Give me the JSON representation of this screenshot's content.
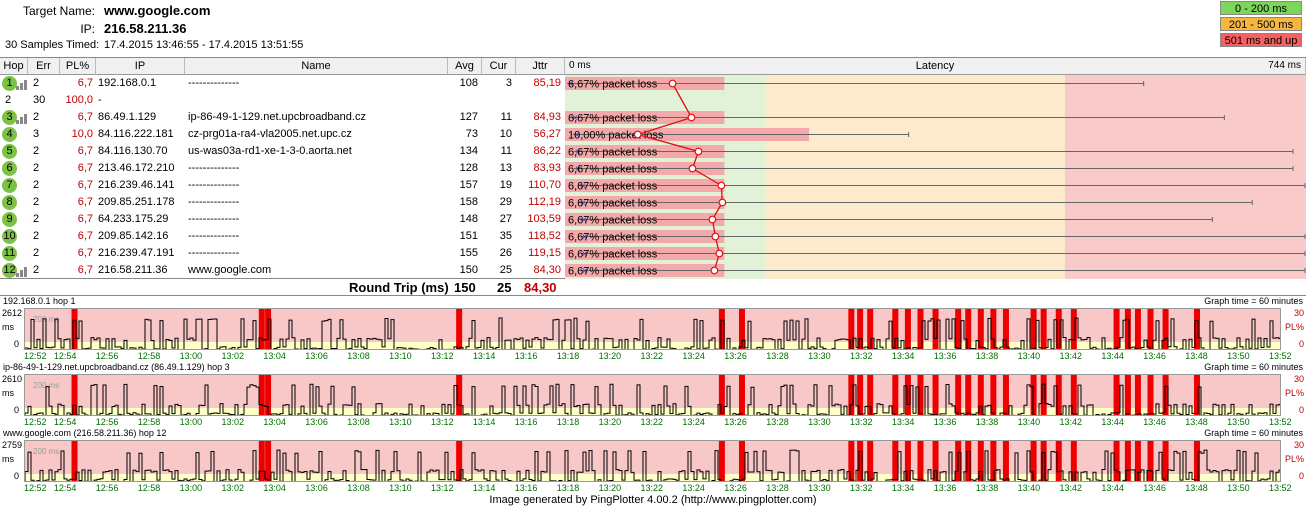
{
  "header": {
    "target_label": "Target Name:",
    "target_value": "www.google.com",
    "ip_label": "IP:",
    "ip_value": "216.58.211.36",
    "samples_label": "30 Samples Timed:",
    "samples_value": "17.4.2015 13:46:55 - 17.4.2015 13:51:55",
    "legend": [
      {
        "label": "0 - 200 ms",
        "color": "#7cd65a"
      },
      {
        "label": "201 - 500 ms",
        "color": "#f5b742"
      },
      {
        "label": "501 ms and up",
        "color": "#f56060"
      }
    ]
  },
  "columns": {
    "hop": "Hop",
    "err": "Err",
    "pl": "PL%",
    "ip": "IP",
    "name": "Name",
    "avg": "Avg",
    "cur": "Cur",
    "jttr": "Jttr",
    "latency": "Latency",
    "lat_min": "0 ms",
    "lat_max": "744 ms"
  },
  "hops": [
    {
      "hop": "1",
      "err": "2",
      "pl": "6,7",
      "ip": "192.168.0.1",
      "name": "--------------",
      "avg": "108",
      "cur": "3",
      "jttr": "85,19",
      "loss": "6,67% packet loss",
      "badge": true,
      "bars": true,
      "avg_ms": 108,
      "min_ms": 2,
      "max_ms": 581,
      "bar_ms": 160
    },
    {
      "hop": "2",
      "err": "30",
      "pl": "100,0",
      "ip": "-",
      "name": "",
      "avg": "",
      "cur": "",
      "jttr": "",
      "loss": "",
      "badge": false,
      "bars": false
    },
    {
      "hop": "3",
      "err": "2",
      "pl": "6,7",
      "ip": "86.49.1.129",
      "name": "ip-86-49-1-129.net.upcbroadband.cz",
      "avg": "127",
      "cur": "11",
      "jttr": "84,93",
      "loss": "6,67% packet loss",
      "badge": true,
      "bars": true,
      "avg_ms": 127,
      "min_ms": 6,
      "max_ms": 662,
      "bar_ms": 160
    },
    {
      "hop": "4",
      "err": "3",
      "pl": "10,0",
      "ip": "84.116.222.181",
      "name": "cz-prg01a-ra4-vla2005.net.upc.cz",
      "avg": "73",
      "cur": "10",
      "jttr": "56,27",
      "loss": "10,00% packet loss",
      "badge": true,
      "bars": false,
      "avg_ms": 73,
      "min_ms": 8,
      "max_ms": 345,
      "bar_ms": 245
    },
    {
      "hop": "5",
      "err": "2",
      "pl": "6,7",
      "ip": "84.116.130.70",
      "name": "us-was03a-rd1-xe-1-3-0.aorta.net",
      "avg": "134",
      "cur": "11",
      "jttr": "86,22",
      "loss": "6,67% packet loss",
      "badge": true,
      "bars": false,
      "avg_ms": 134,
      "min_ms": 9,
      "max_ms": 731,
      "bar_ms": 160
    },
    {
      "hop": "6",
      "err": "2",
      "pl": "6,7",
      "ip": "213.46.172.210",
      "name": "--------------",
      "avg": "128",
      "cur": "13",
      "jttr": "83,93",
      "loss": "6,67% packet loss",
      "badge": true,
      "bars": false,
      "avg_ms": 128,
      "min_ms": 9,
      "max_ms": 731,
      "bar_ms": 160
    },
    {
      "hop": "7",
      "err": "2",
      "pl": "6,7",
      "ip": "216.239.46.141",
      "name": "--------------",
      "avg": "157",
      "cur": "19",
      "jttr": "110,70",
      "loss": "6,67% packet loss",
      "badge": true,
      "bars": false,
      "avg_ms": 157,
      "min_ms": 14,
      "max_ms": 744,
      "bar_ms": 160
    },
    {
      "hop": "8",
      "err": "2",
      "pl": "6,7",
      "ip": "209.85.251.178",
      "name": "--------------",
      "avg": "158",
      "cur": "29",
      "jttr": "112,19",
      "loss": "6,67% packet loss",
      "badge": true,
      "bars": false,
      "avg_ms": 158,
      "min_ms": 14,
      "max_ms": 690,
      "bar_ms": 160
    },
    {
      "hop": "9",
      "err": "2",
      "pl": "6,7",
      "ip": "64.233.175.29",
      "name": "--------------",
      "avg": "148",
      "cur": "27",
      "jttr": "103,59",
      "loss": "6,67% packet loss",
      "badge": true,
      "bars": false,
      "avg_ms": 148,
      "min_ms": 15,
      "max_ms": 650,
      "bar_ms": 160
    },
    {
      "hop": "10",
      "err": "2",
      "pl": "6,7",
      "ip": "209.85.142.16",
      "name": "--------------",
      "avg": "151",
      "cur": "35",
      "jttr": "118,52",
      "loss": "6,67% packet loss",
      "badge": true,
      "bars": false,
      "avg_ms": 151,
      "min_ms": 16,
      "max_ms": 744,
      "bar_ms": 160
    },
    {
      "hop": "11",
      "err": "2",
      "pl": "6,7",
      "ip": "216.239.47.191",
      "name": "--------------",
      "avg": "155",
      "cur": "26",
      "jttr": "119,15",
      "loss": "6,67% packet loss",
      "badge": true,
      "bars": false,
      "avg_ms": 155,
      "min_ms": 16,
      "max_ms": 744,
      "bar_ms": 160
    },
    {
      "hop": "12",
      "err": "2",
      "pl": "6,7",
      "ip": "216.58.211.36",
      "name": "www.google.com",
      "avg": "150",
      "cur": "25",
      "jttr": "84,30",
      "loss": "6,67% packet loss",
      "badge": true,
      "bars": true,
      "avg_ms": 150,
      "min_ms": 16,
      "max_ms": 744,
      "bar_ms": 160
    }
  ],
  "round_trip": {
    "label": "Round Trip (ms)",
    "avg": "150",
    "cur": "25",
    "jttr": "84,30"
  },
  "mini_graphs": [
    {
      "title": "192.168.0.1 hop 1",
      "max": "2612",
      "unit": "ms",
      "zero": "0",
      "pl_max": "30",
      "pl_min": "0",
      "pl_label": "PL%",
      "graph_time": "Graph time = 60 minutes",
      "band_label": "200 ms",
      "seed": 3
    },
    {
      "title": "ip-86-49-1-129.net.upcbroadband.cz (86.49.1.129) hop 3",
      "max": "2610",
      "unit": "ms",
      "zero": "0",
      "pl_max": "30",
      "pl_min": "0",
      "pl_label": "PL%",
      "graph_time": "Graph time = 60 minutes",
      "band_label": "200 ms",
      "seed": 7
    },
    {
      "title": "www.google.com (216.58.211.36) hop 12",
      "max": "2759",
      "unit": "ms",
      "zero": "0",
      "pl_max": "30",
      "pl_min": "0",
      "pl_label": "PL%",
      "graph_time": "Graph time = 60 minutes",
      "band_label": "200 ms",
      "seed": 11
    }
  ],
  "time_labels": [
    "12:52",
    "12:54",
    "12:56",
    "12:58",
    "13:00",
    "13:02",
    "13:04",
    "13:06",
    "13:08",
    "13:10",
    "13:12",
    "13:14",
    "13:16",
    "13:18",
    "13:20",
    "13:22",
    "13:24",
    "13:26",
    "13:28",
    "13:30",
    "13:32",
    "13:34",
    "13:36",
    "13:38",
    "13:40",
    "13:42",
    "13:44",
    "13:46",
    "13:48",
    "13:50",
    "13:52"
  ],
  "loss_positions": [
    0.037,
    0.186,
    0.191,
    0.343,
    0.552,
    0.568,
    0.655,
    0.662,
    0.67,
    0.69,
    0.7,
    0.71,
    0.722,
    0.74,
    0.748,
    0.758,
    0.768,
    0.778,
    0.8,
    0.808,
    0.82,
    0.832,
    0.866,
    0.875,
    0.883,
    0.893,
    0.905,
    0.93
  ],
  "footer": "Image generated by PingPlotter 4.00.2 (http://www.pingplotter.com)"
}
